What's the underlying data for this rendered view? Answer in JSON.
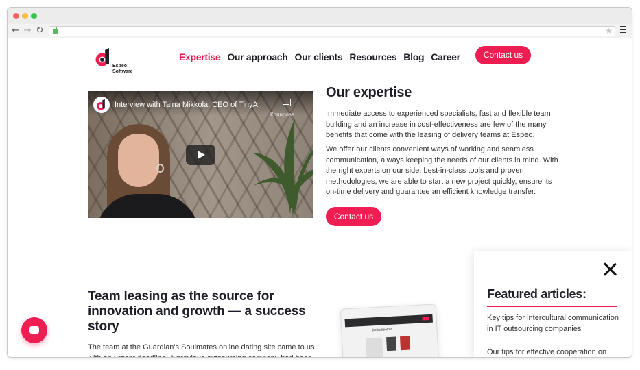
{
  "browser": {
    "window_controls": [
      "close",
      "minimize",
      "maximize"
    ]
  },
  "logo": {
    "line1": "Espeo",
    "line2": "Software",
    "brand_color": "#ee1e52"
  },
  "nav": {
    "items": [
      "Expertise",
      "Our approach",
      "Our clients",
      "Resources",
      "Blog",
      "Career"
    ],
    "active": "Expertise",
    "cta": "Contact us"
  },
  "video": {
    "title": "Interview with Taina Mikkola, CEO of TinyA...",
    "copy_label": "Копирова..."
  },
  "expertise": {
    "heading": "Our expertise",
    "p1": "Immediate access to experienced specialists, fast and flexible team building and an increase in cost-effectiveness are few of the many benefits that come with the leasing of delivery teams at Espeo.",
    "p2": "We offer our clients convenient ways of working and seamless communication, always keeping the needs of our clients in mind. With the right experts on our side, best-in-class tools and proven methodologies, we are able to start a new project quickly, ensure its on-time delivery and guarantee an efficient knowledge transfer.",
    "cta": "Contact us"
  },
  "story": {
    "heading": "Team leasing as the source for innovation and growth — a success story",
    "text": "The team at the Guardian's Soulmates online dating site came to us with an urgent deadline. A previous outsourcing company had been",
    "laptop_title": "Dzikodzielnia"
  },
  "featured": {
    "heading": "Featured articles:",
    "items": [
      "Key tips for intercultural communication in IT outsourcing companies",
      "Our tips for effective cooperation on outsourcing software development"
    ]
  },
  "colors": {
    "accent": "#ee1e52",
    "text": "#1f1f2a"
  }
}
